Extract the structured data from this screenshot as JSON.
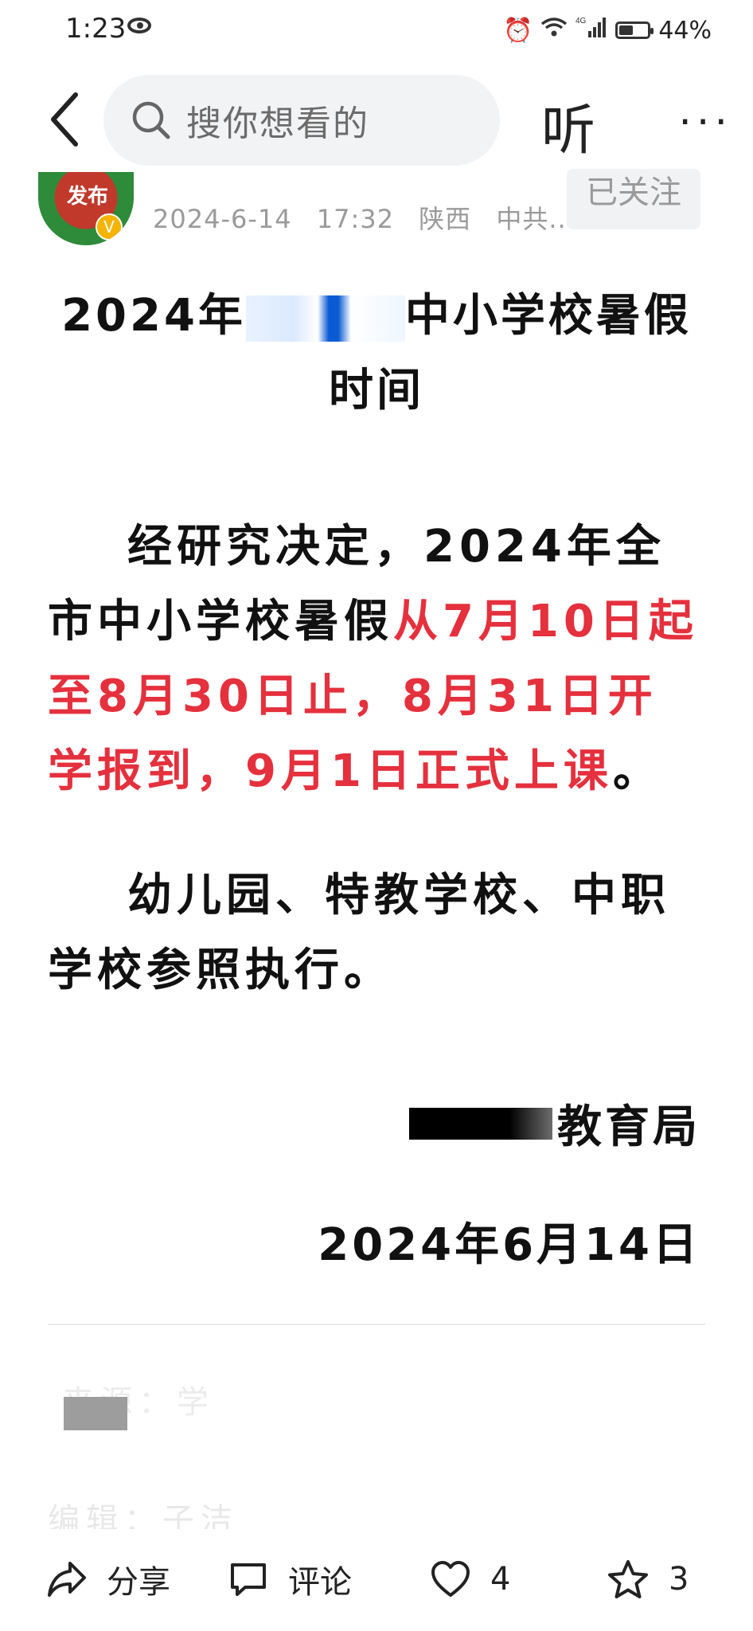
{
  "status_bar": {
    "time": "1:23",
    "network": "4G",
    "battery": "44%"
  },
  "header": {
    "search_placeholder": "搜你想看的",
    "listen_label": "听",
    "more_label": "···"
  },
  "author": {
    "avatar_text": "发布",
    "verified_badge": "V",
    "date": "2024-6-14",
    "time": "17:32",
    "location": "陕西",
    "source": "中共...",
    "follow_label": "已关注"
  },
  "article": {
    "title_part1": "2024年",
    "title_part2": "中小学校暑假",
    "title_line2": "时间",
    "para1_normal": "经研究决定，2024年全市中小学校暑假",
    "para1_red": "从7月10日起至8月30日止，8月31日开学报到，9月1日正式上课",
    "para1_end": "。",
    "para2": "幼儿园、特教学校、中职学校参照执行。",
    "issuer_suffix": "教育局",
    "date": "2024年6月14日"
  },
  "footer_faint": {
    "line1": "来源：学",
    "line2": "编辑：子洁"
  },
  "bottom_bar": {
    "share_label": "分享",
    "comment_label": "评论",
    "like_count": "4",
    "favorite_count": "3"
  },
  "colors": {
    "accent_red": "#e5303d",
    "text": "#111111",
    "muted": "#9a9a9a"
  }
}
